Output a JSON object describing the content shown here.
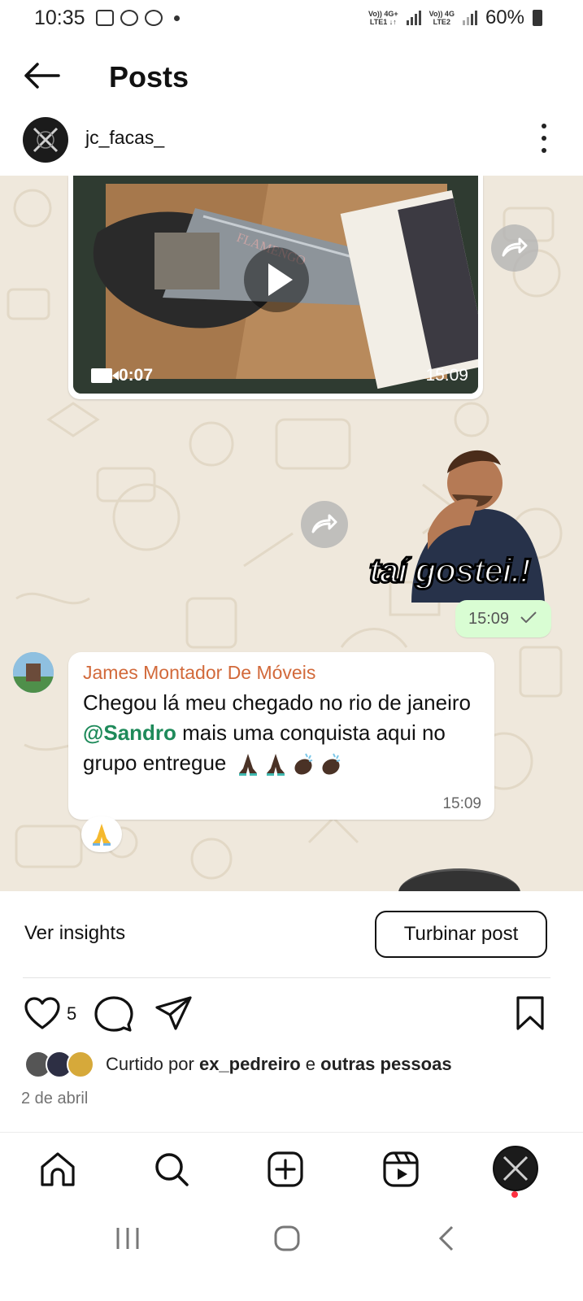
{
  "status_bar": {
    "time": "10:35",
    "network_1": "Vo)) 4G+\nLTE1 ↓↑",
    "network_2": "Vo)) 4G\nLTE2",
    "battery": "60%"
  },
  "header": {
    "title": "Posts"
  },
  "post": {
    "username": "jc_facas_",
    "image": {
      "video": {
        "duration": "0:07",
        "time": "15:09"
      },
      "sticker_text": "taí gostei.!",
      "sticker_time": "15:09",
      "message": {
        "sender": "James Montador De Móveis",
        "text_before": "Chegou lá meu chegado no rio de janeiro ",
        "mention": "@Sandro",
        "text_after": " mais uma conquista aqui no grupo entregue",
        "time": "15:09"
      }
    },
    "insights_label": "Ver insights",
    "boost_label": "Turbinar post",
    "like_count": "5",
    "liked_by_prefix": "Curtido por ",
    "liked_by_user": "ex_pedreiro",
    "liked_by_joiner": " e ",
    "liked_by_suffix": "outras pessoas",
    "date": "2 de abril"
  },
  "icons": {
    "back": "arrow-left-icon",
    "more": "more-vertical-icon",
    "like": "heart-icon",
    "comment": "comment-icon",
    "share": "send-icon",
    "save": "bookmark-icon",
    "home": "home-icon",
    "search": "search-icon",
    "create": "plus-square-icon",
    "reels": "reels-icon"
  },
  "colors": {
    "chat_background": "#efe8dc",
    "sender_name": "#d2693a",
    "mention": "#1e8a5a",
    "sent_bubble": "#d9fdd3",
    "notification_dot": "#ff3040"
  }
}
